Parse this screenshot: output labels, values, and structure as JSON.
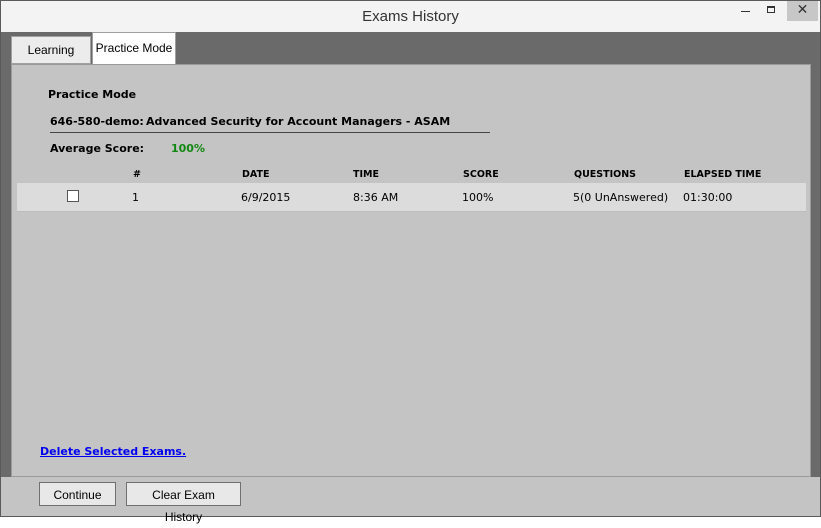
{
  "window": {
    "title": "Exams History",
    "controls": {
      "minimize": "—",
      "maximize": "□",
      "close": "✕"
    }
  },
  "tabs": [
    {
      "label": "Learning Mode",
      "active": false
    },
    {
      "label": "Practice Mode",
      "active": true
    }
  ],
  "main": {
    "heading": "Practice Mode",
    "exam_code": "646-580-demo:",
    "exam_name": "Advanced Security for Account Managers - ASAM",
    "average_label": "Average Score:",
    "average_value": "100%",
    "average_color": "#118811"
  },
  "table": {
    "columns": [
      "#",
      "DATE",
      "TIME",
      "SCORE",
      "QUESTIONS",
      "ELAPSED TIME"
    ],
    "rows": [
      {
        "checked": false,
        "num": "1",
        "date": "6/9/2015",
        "time": "8:36 AM",
        "score": "100%",
        "questions": "5(0 UnAnswered)",
        "elapsed": "01:30:00"
      }
    ]
  },
  "delete_link": "Delete Selected Exams.",
  "buttons": {
    "continue": "Continue",
    "clear": "Clear Exam History"
  },
  "colors": {
    "frame": "#6a6a6a",
    "panel": "#c4c4c4",
    "row": "#dcdcdc",
    "link": "#0000ee"
  }
}
